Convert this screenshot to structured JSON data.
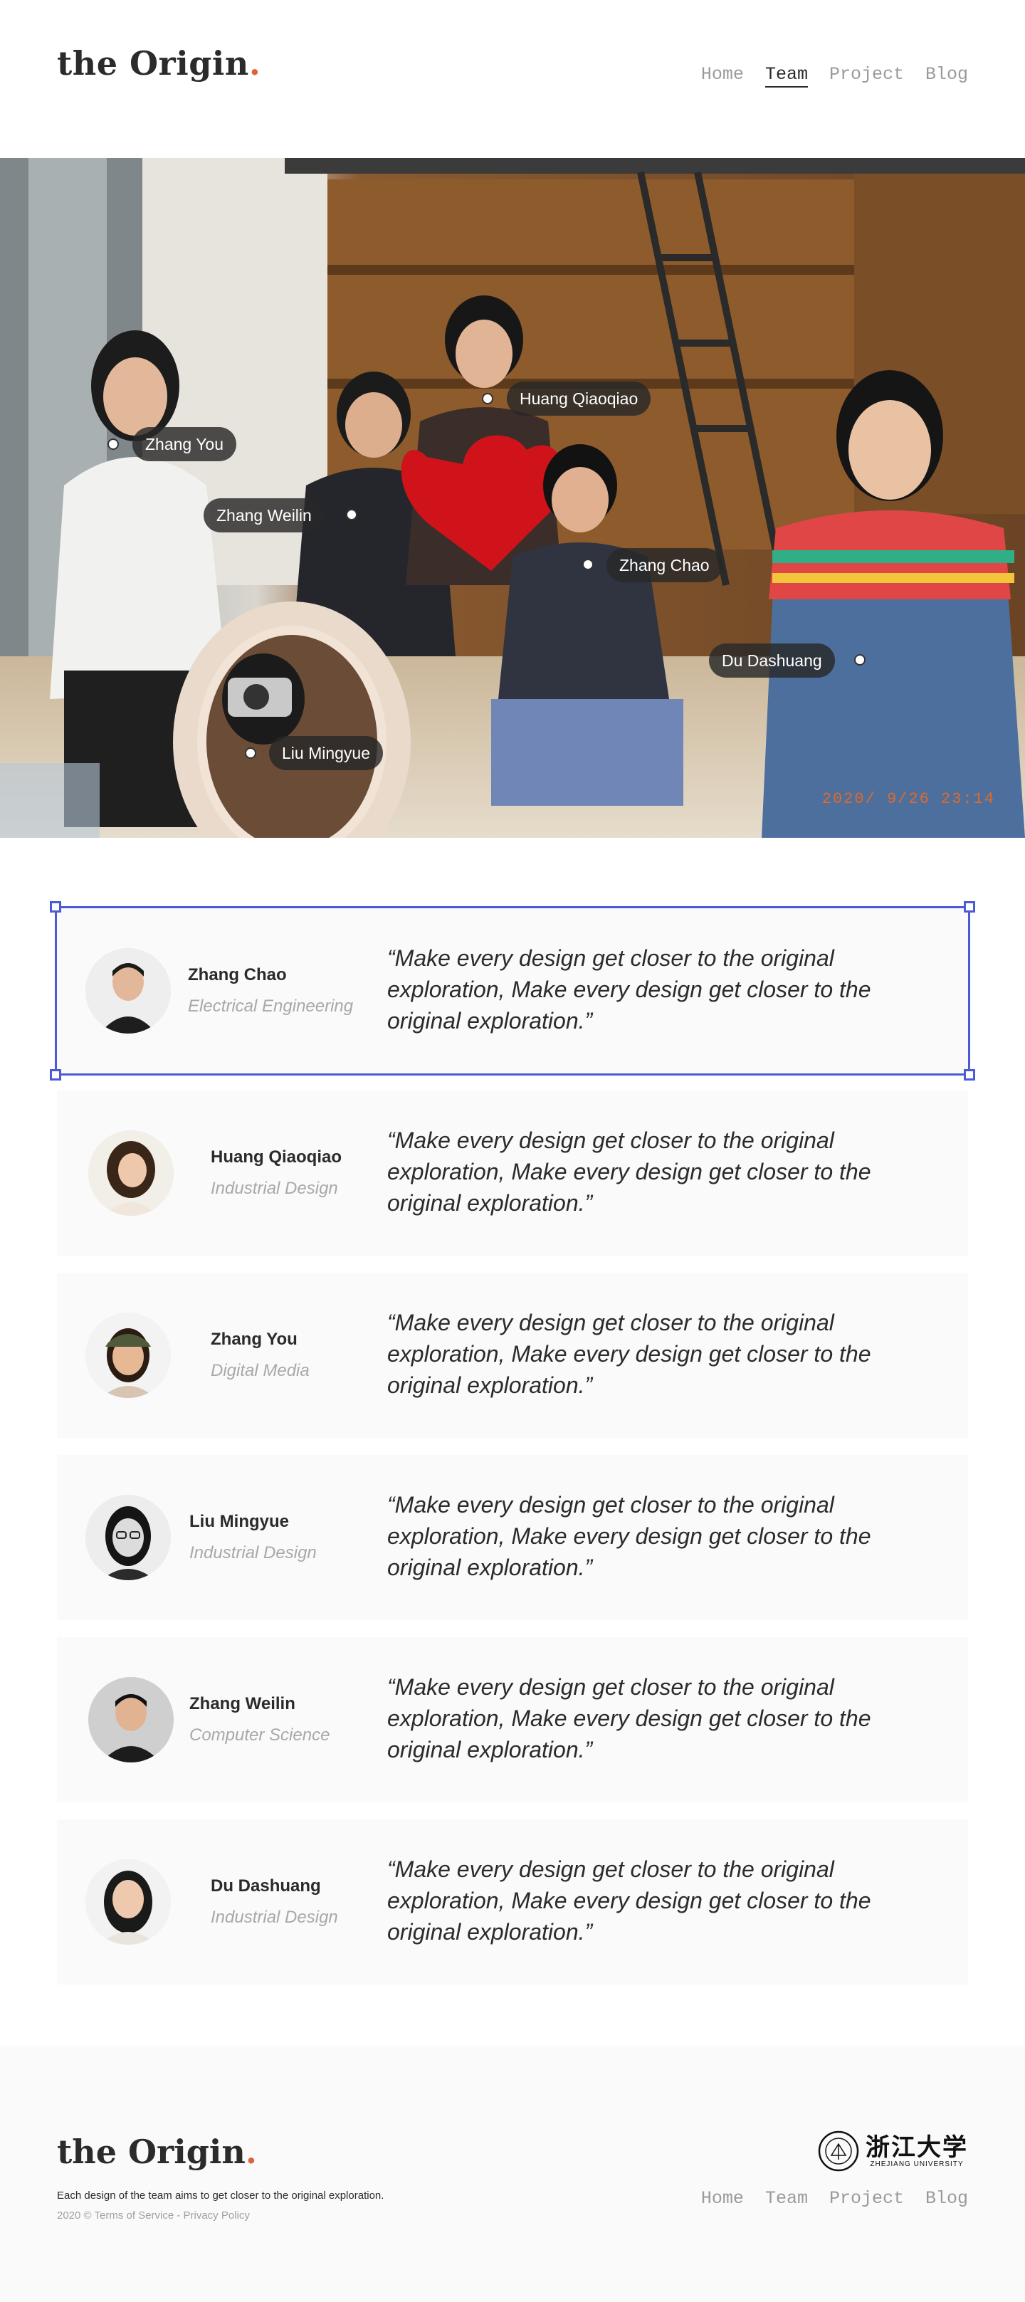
{
  "header": {
    "logo": "the Origin",
    "logo_dot": ".",
    "nav": [
      "Home",
      "Team",
      "Project",
      "Blog"
    ],
    "active_nav": "Team"
  },
  "hero": {
    "timestamp": "2020/ 9/26 23:14",
    "tags": [
      {
        "label": "Huang Qiaoqiao"
      },
      {
        "label": "Zhang You"
      },
      {
        "label": "Zhang Weilin"
      },
      {
        "label": "Zhang Chao"
      },
      {
        "label": "Du Dashuang"
      },
      {
        "label": "Liu Mingyue"
      }
    ]
  },
  "team": [
    {
      "name": "Zhang Chao",
      "major": "Electrical Engineering",
      "quote": "“Make every design get closer to the original exploration, Make every design get closer to the original exploration.”"
    },
    {
      "name": "Huang Qiaoqiao",
      "major": "Industrial Design",
      "quote": "“Make every design get closer to the original exploration, Make every design get closer to the original exploration.”"
    },
    {
      "name": "Zhang You",
      "major": "Digital Media",
      "quote": "“Make every design get closer to the original exploration, Make every design get closer to the original exploration.”"
    },
    {
      "name": "Liu Mingyue",
      "major": "Industrial Design",
      "quote": "“Make every design get closer to the original exploration, Make every design get closer to the original exploration.”"
    },
    {
      "name": "Zhang Weilin",
      "major": "Computer Science",
      "quote": "“Make every design get closer to the original exploration, Make every design get closer to the original exploration.”"
    },
    {
      "name": "Du Dashuang",
      "major": "Industrial Design",
      "quote": "“Make every design get closer to the original exploration, Make every design get closer to the original exploration.”"
    }
  ],
  "footer": {
    "logo": "the Origin",
    "logo_dot": ".",
    "tagline": "Each design of the team aims to get closer to the original exploration.",
    "copyright": "2020 © Terms of Service - Privacy Policy",
    "nav": [
      "Home",
      "Team",
      "Project",
      "Blog"
    ],
    "university_cn": "浙江大学",
    "university_en": "ZHEJIANG UNIVERSITY"
  },
  "colors": {
    "accent": "#e0623a",
    "selection": "#4c5bd4",
    "card_bg": "#fafafa"
  }
}
